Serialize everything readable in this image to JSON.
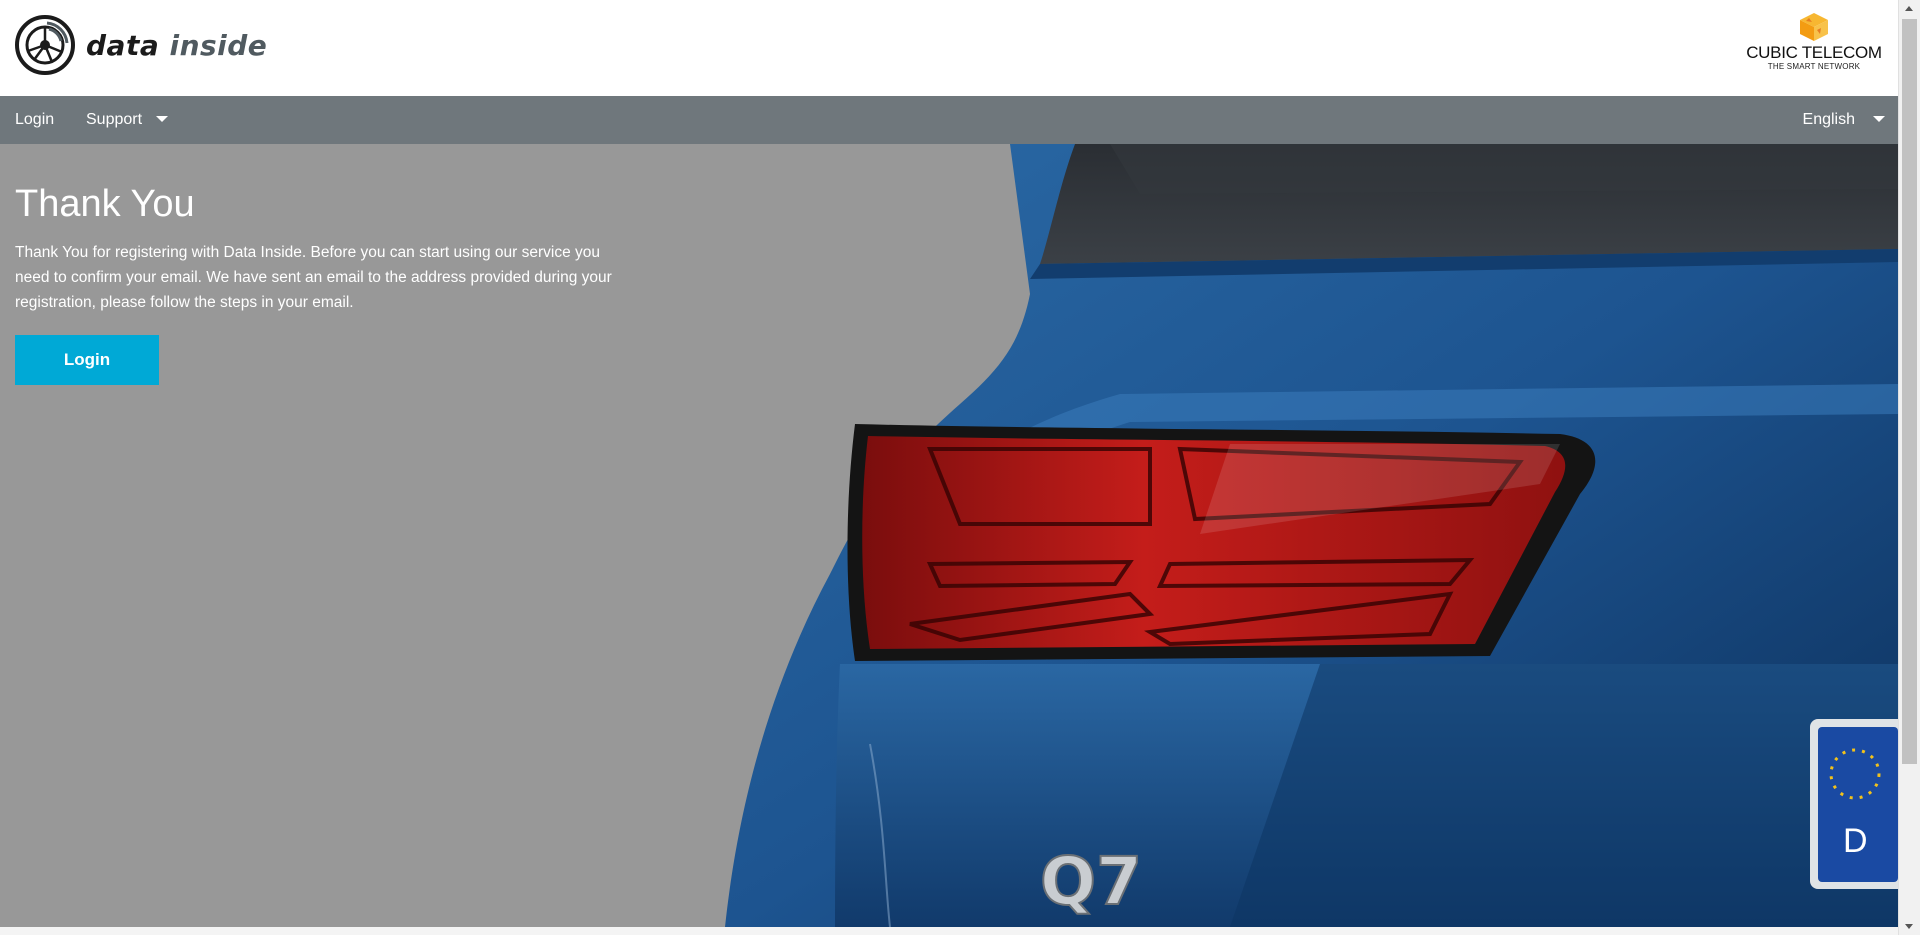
{
  "header": {
    "brand": {
      "word1": "data",
      "word2": "inside",
      "icon": "wheel-signal-logo"
    },
    "partner": {
      "name": "CUBIC TELECOM",
      "tagline": "THE SMART NETWORK",
      "icon": "cube-logo"
    }
  },
  "nav": {
    "login_label": "Login",
    "support_label": "Support",
    "language_label": "English"
  },
  "main": {
    "title": "Thank You",
    "message": "Thank You for registering with Data Inside. Before you can start using our service you need to confirm your email. We have sent an email to the address provided during your registration, please follow the steps in your email.",
    "login_button_label": "Login"
  },
  "hero_image": {
    "badge": "Q7",
    "plate_letter": "D"
  },
  "colors": {
    "nav_bg": "#6f777c",
    "hero_bg": "#989898",
    "accent": "#00a9d6",
    "car_blue": "#1f5590"
  }
}
